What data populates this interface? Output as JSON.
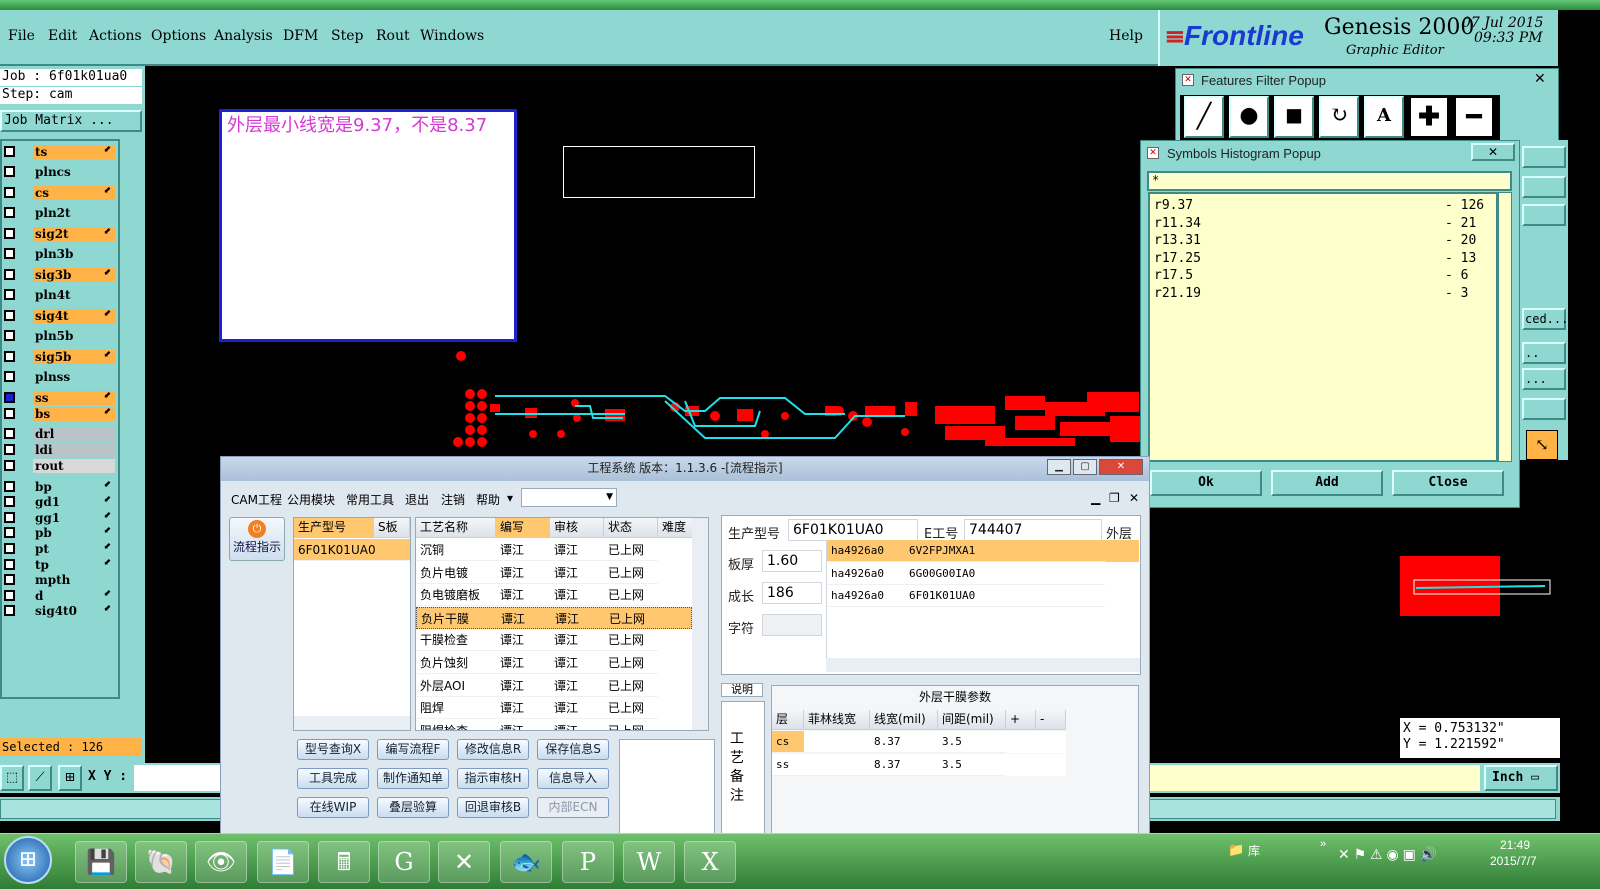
{
  "menubar": {
    "items": [
      "File",
      "Edit",
      "Actions",
      "Options",
      "Analysis",
      "DFM",
      "Step",
      "Rout",
      "Windows"
    ],
    "help": "Help"
  },
  "brand": {
    "logo": "Frontline",
    "product": "Genesis 2000",
    "subtitle": "Graphic Editor",
    "date": "07 Jul 2015",
    "time": "09:33 PM"
  },
  "job": {
    "job_line": "Job : 6f01k01ua0",
    "step_line": "Step: cam",
    "job_matrix": "Job Matrix ..."
  },
  "layers": [
    {
      "name": "ts",
      "color": "#ffb347",
      "arrow": "⬋"
    },
    {
      "name": "plncs",
      "color": "#8fd8d2",
      "arrow": ""
    },
    {
      "name": "cs",
      "color": "#ffb347",
      "arrow": "⬋"
    },
    {
      "name": "pln2t",
      "color": "#8fd8d2",
      "arrow": ""
    },
    {
      "name": "sig2t",
      "color": "#ffb347",
      "arrow": "⬋"
    },
    {
      "name": "pln3b",
      "color": "#8fd8d2",
      "arrow": ""
    },
    {
      "name": "sig3b",
      "color": "#ffb347",
      "arrow": "⬋"
    },
    {
      "name": "pln4t",
      "color": "#8fd8d2",
      "arrow": ""
    },
    {
      "name": "sig4t",
      "color": "#ffb347",
      "arrow": "⬋"
    },
    {
      "name": "pln5b",
      "color": "#8fd8d2",
      "arrow": ""
    },
    {
      "name": "sig5b",
      "color": "#ffb347",
      "arrow": "⬋"
    },
    {
      "name": "plnss",
      "color": "#8fd8d2",
      "arrow": ""
    },
    {
      "name": "ss",
      "color": "#ffb347",
      "arrow": "⬋"
    },
    {
      "name": "bs",
      "color": "#ffb347",
      "arrow": "⬋"
    },
    {
      "name": "drl",
      "color": "#b8c4c8",
      "arrow": ""
    },
    {
      "name": "ldi",
      "color": "#b8c4c8",
      "arrow": ""
    },
    {
      "name": "rout",
      "color": "#d8d8d8",
      "arrow": ""
    },
    {
      "name": "bp",
      "color": "#8fd8d2",
      "arrow": "⬋"
    },
    {
      "name": "gd1",
      "color": "#8fd8d2",
      "arrow": "⬋"
    },
    {
      "name": "gg1",
      "color": "#8fd8d2",
      "arrow": "⬋"
    },
    {
      "name": "pb",
      "color": "#8fd8d2",
      "arrow": "⬋"
    },
    {
      "name": "pt",
      "color": "#8fd8d2",
      "arrow": "⬋"
    },
    {
      "name": "tp",
      "color": "#8fd8d2",
      "arrow": "⬋"
    },
    {
      "name": "mpth",
      "color": "#8fd8d2",
      "arrow": ""
    },
    {
      "name": "d",
      "color": "#8fd8d2",
      "arrow": "⬋"
    },
    {
      "name": "sig4t0",
      "color": "#8fd8d2",
      "arrow": "⬋"
    }
  ],
  "selected": "Selected : 126",
  "xy_label": "X Y :",
  "note_text": "外层最小线宽是9.37，不是8.37",
  "features_popup": {
    "title": "Features Filter Popup"
  },
  "histogram": {
    "title": "Symbols Histogram Popup",
    "filter": "*",
    "rows": [
      {
        "sym": "r9.37",
        "count": "- 126"
      },
      {
        "sym": "r11.34",
        "count": "- 21"
      },
      {
        "sym": "r13.31",
        "count": "- 20"
      },
      {
        "sym": "r17.25",
        "count": "- 13"
      },
      {
        "sym": "r17.5",
        "count": "- 6"
      },
      {
        "sym": "r21.19",
        "count": "- 3"
      }
    ],
    "ok": "Ok",
    "add": "Add",
    "close": "Close"
  },
  "right_col": {
    "b1": "ced...",
    "b2": "..",
    "b3": "..."
  },
  "coords": {
    "x": "X = 0.753132\"",
    "y": "Y = 1.221592\""
  },
  "units": "Inch",
  "cam": {
    "title": "工程系统  版本：1.1.3.6 -[流程指示]",
    "menu": [
      "CAM工程",
      "公用模块",
      "常用工具",
      "退出",
      "注销",
      "帮助"
    ],
    "flow_btn": "流程指示",
    "model_grid": {
      "headers": [
        "生产型号",
        "S板"
      ],
      "rows": [
        "6F01K01UA0"
      ]
    },
    "process_grid": {
      "headers": [
        "工艺名称",
        "编写",
        "审核",
        "状态",
        "难度"
      ],
      "rows": [
        [
          "沉铜",
          "谭江",
          "谭江",
          "已上网"
        ],
        [
          "负片电镀",
          "谭江",
          "谭江",
          "已上网"
        ],
        [
          "负电镀磨板",
          "谭江",
          "谭江",
          "已上网"
        ],
        [
          "负片干膜",
          "谭江",
          "谭江",
          "已上网"
        ],
        [
          "干膜检查",
          "谭江",
          "谭江",
          "已上网"
        ],
        [
          "负片蚀刻",
          "谭江",
          "谭江",
          "已上网"
        ],
        [
          "外层AOI",
          "谭江",
          "谭江",
          "已上网"
        ],
        [
          "阻焊",
          "谭江",
          "谭江",
          "已上网"
        ],
        [
          "阻焊检查",
          "谭江",
          "谭江",
          "已上网"
        ]
      ]
    },
    "buttons": [
      [
        "型号查询X",
        "编写流程F",
        "修改信息R",
        "保存信息S"
      ],
      [
        "工具完成",
        "制作通知单",
        "指示审核H",
        "信息导入"
      ],
      [
        "在线WIP",
        "叠层验算",
        "回退审核B",
        "内部ECN"
      ]
    ],
    "info": {
      "model_label": "生产型号",
      "model_value": "6F01K01UA0",
      "eno_label": "E工号",
      "eno_value": "744407",
      "outer_label": "外层",
      "thick_label": "板厚",
      "thick_value": "1.60",
      "grow_label": "成长",
      "grow_value": "186",
      "char_label": "字符",
      "char_value": ""
    },
    "side_rows": [
      [
        "ha4926a0",
        "6V2FPJMXA1"
      ],
      [
        "ha4926a0",
        "6G00G00IA0"
      ],
      [
        "ha4926a0",
        "6F01K01UA0"
      ]
    ],
    "tab_label": "说明",
    "remark_label": "工艺备注",
    "param": {
      "title": "外层干膜参数",
      "headers": [
        "层",
        "菲林线宽",
        "线宽(mil)",
        "间距(mil)",
        "+",
        "-"
      ],
      "rows": [
        [
          "cs",
          "",
          "8.37",
          "3.5"
        ],
        [
          "ss",
          "",
          "8.37",
          "3.5"
        ]
      ]
    }
  },
  "taskbar": {
    "tray_label": "库",
    "time": "21:49",
    "date": "2015/7/7"
  }
}
